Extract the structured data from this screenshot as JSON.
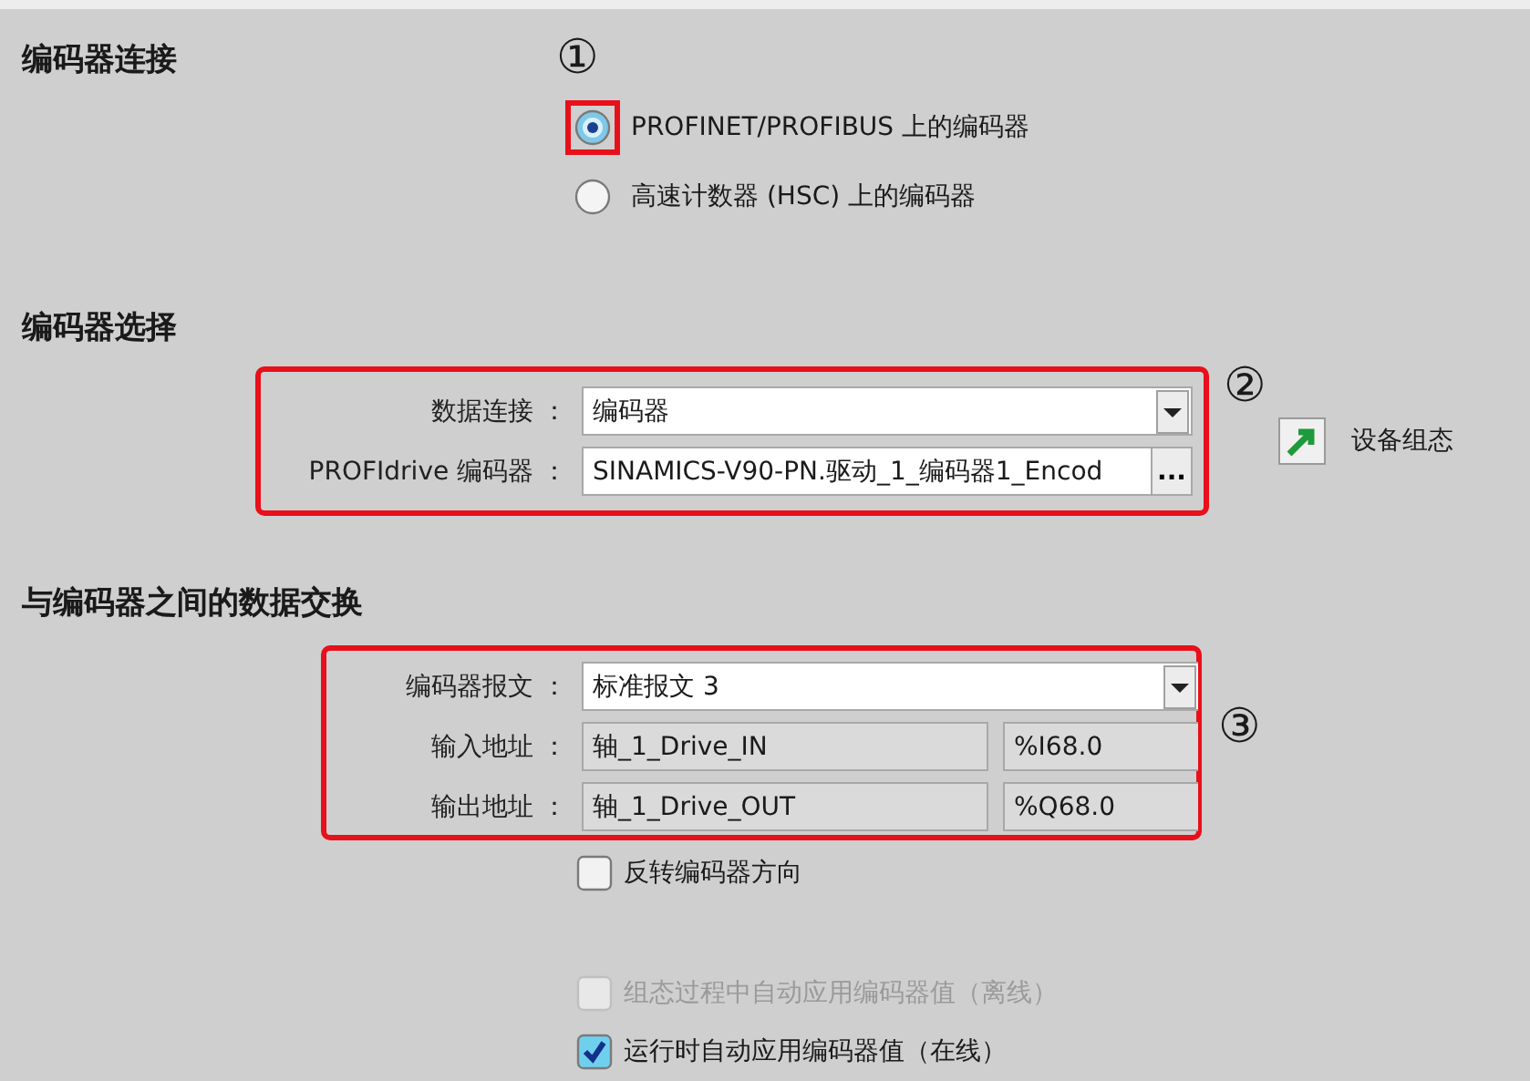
{
  "encoder_connection": {
    "heading": "编码器连接",
    "marker": "①",
    "options": [
      {
        "label": "PROFINET/PROFIBUS 上的编码器",
        "selected": true,
        "highlighted": true
      },
      {
        "label": "高速计数器 (HSC) 上的编码器",
        "selected": false,
        "highlighted": false
      }
    ]
  },
  "encoder_selection": {
    "heading": "编码器选择",
    "marker": "②",
    "fields": [
      {
        "kind": "dropdown",
        "label": "数据连接 ：",
        "value": "编码器"
      },
      {
        "kind": "browse",
        "label": "PROFIdrive 编码器 ：",
        "value": "SINAMICS-V90-PN.驱动_1_编码器1_Encod",
        "button": "..."
      }
    ],
    "device_config_button": "设备组态"
  },
  "data_exchange": {
    "heading": "与编码器之间的数据交换",
    "marker": "③",
    "fields": [
      {
        "kind": "dropdown",
        "label": "编码器报文 ：",
        "value": "标准报文 3"
      },
      {
        "kind": "address",
        "label": "输入地址 ：",
        "value": "轴_1_Drive_IN",
        "address": "%I68.0"
      },
      {
        "kind": "address",
        "label": "输出地址 ：",
        "value": "轴_1_Drive_OUT",
        "address": "%Q68.0"
      }
    ],
    "checkboxes": [
      {
        "label": "反转编码器方向",
        "checked": false,
        "disabled": false
      },
      {
        "label": "组态过程中自动应用编码器值（离线）",
        "checked": false,
        "disabled": true
      },
      {
        "label": "运行时自动应用编码器值（在线）",
        "checked": true,
        "disabled": false
      }
    ]
  }
}
